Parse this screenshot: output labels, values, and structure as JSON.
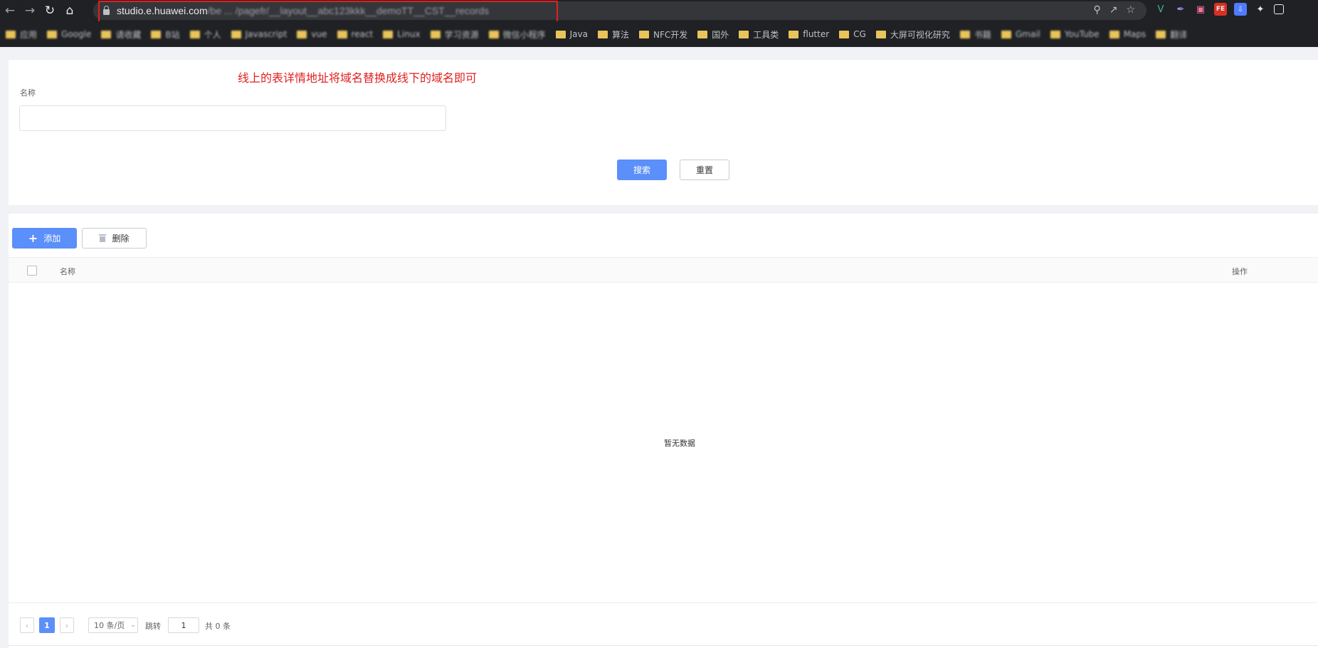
{
  "browser": {
    "url_host": "studio.e.huawei.com",
    "url_path": "/be ... /pagefr/__layout__abc123kkk__demoTT__CST__records",
    "bookmarks": [
      {
        "label": "应用",
        "blur": true
      },
      {
        "label": "Google",
        "blur": true
      },
      {
        "label": "请收藏",
        "blur": true
      },
      {
        "label": "B站",
        "blur": true
      },
      {
        "label": "个人",
        "blur": true
      },
      {
        "label": "Javascript",
        "blur": true
      },
      {
        "label": "vue",
        "blur": true
      },
      {
        "label": "react",
        "blur": true
      },
      {
        "label": "Linux",
        "blur": true
      },
      {
        "label": "学习资源",
        "blur": true
      },
      {
        "label": "微信小程序",
        "blur": true
      },
      {
        "label": "Java",
        "blur": false
      },
      {
        "label": "算法",
        "blur": false
      },
      {
        "label": "NFC开发",
        "blur": false
      },
      {
        "label": "国外",
        "blur": false
      },
      {
        "label": "工具类",
        "blur": false
      },
      {
        "label": "flutter",
        "blur": false
      },
      {
        "label": "CG",
        "blur": false
      },
      {
        "label": "大屏可视化研究",
        "blur": false
      },
      {
        "label": "书籍",
        "blur": true
      },
      {
        "label": "Gmail",
        "blur": true
      },
      {
        "label": "YouTube",
        "blur": true
      },
      {
        "label": "Maps",
        "blur": true
      },
      {
        "label": "翻译",
        "blur": true
      }
    ]
  },
  "annotation": "线上的表详情地址将域名替换成线下的域名即可",
  "search_form": {
    "name_label": "名称",
    "name_value": "",
    "search_label": "搜索",
    "reset_label": "重置"
  },
  "toolbar": {
    "add_label": "添加",
    "delete_label": "删除"
  },
  "table": {
    "col_name": "名称",
    "col_op": "操作",
    "empty_text": "暂无数据"
  },
  "pagination": {
    "current_page": "1",
    "page_size": "10 条/页",
    "jump_label": "跳转",
    "jump_value": "1",
    "total_text": "共 0 条"
  },
  "colors": {
    "primary": "#5b8ff9",
    "annotation_red": "#e02020"
  }
}
